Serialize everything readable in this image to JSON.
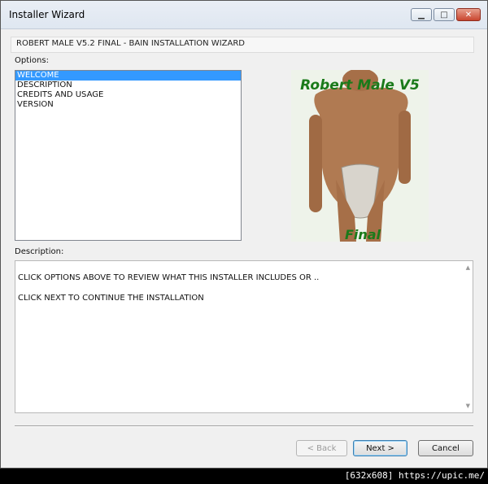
{
  "window": {
    "title": "Installer Wizard"
  },
  "caption_buttons": {
    "minimize": "▁",
    "maximize": "□",
    "close": "✕"
  },
  "header": {
    "text": "ROBERT MALE V5.2 FINAL - BAIN INSTALLATION WIZARD"
  },
  "options": {
    "label": "Options:",
    "items": [
      "WELCOME",
      "DESCRIPTION",
      "CREDITS AND USAGE",
      "VERSION"
    ],
    "selected": "WELCOME"
  },
  "preview": {
    "title_text": "Robert Male V5",
    "bottom_text": "Final",
    "text_color": "#1a7a1a"
  },
  "description": {
    "label": "Description:",
    "line1": "CLICK OPTIONS ABOVE TO REVIEW WHAT THIS INSTALLER INCLUDES OR ..",
    "line2": "CLICK NEXT TO CONTINUE THE INSTALLATION"
  },
  "buttons": {
    "back": "< Back",
    "next": "Next >",
    "cancel": "Cancel"
  },
  "footer": {
    "text": "[632x608] https://upic.me/"
  }
}
